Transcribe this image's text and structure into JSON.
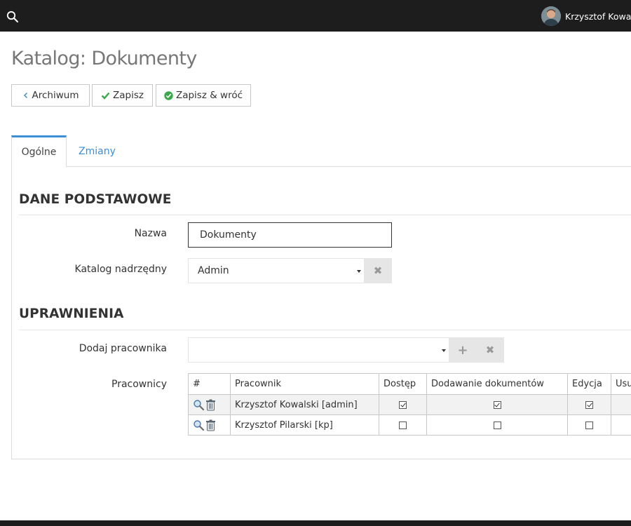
{
  "topbar": {
    "user_name": "Krzysztof Kowals"
  },
  "page": {
    "title": "Katalog: Dokumenty"
  },
  "toolbar": {
    "back_label": "Archiwum",
    "save_label": "Zapisz",
    "save_return_label": "Zapisz & wróć"
  },
  "tabs": [
    {
      "label": "Ogólne",
      "active": true
    },
    {
      "label": "Zmiany",
      "active": false
    }
  ],
  "sections": {
    "basic": {
      "title": "DANE PODSTAWOWE",
      "name_label": "Nazwa",
      "name_value": "Dokumenty",
      "parent_label": "Katalog nadrzędny",
      "parent_value": "Admin"
    },
    "permissions": {
      "title": "UPRAWNIENIA",
      "add_employee_label": "Dodaj pracownika",
      "add_employee_value": "",
      "employees_label": "Pracownicy"
    }
  },
  "employees_table": {
    "columns": [
      "#",
      "Pracownik",
      "Dostęp",
      "Dodawanie dokumentów",
      "Edycja",
      "Usu"
    ],
    "rows": [
      {
        "name": "Krzysztof Kowalski [admin]",
        "access": true,
        "add_docs": true,
        "edit": true
      },
      {
        "name": "Krzysztof Pilarski [kp]",
        "access": false,
        "add_docs": false,
        "edit": false
      }
    ]
  },
  "colors": {
    "topbar": "#1d1d1d",
    "accent": "#3b8fd6",
    "check_green": "#3aa84a"
  },
  "icons": {
    "search": "search-icon",
    "back": "chevron-left-icon",
    "save": "checkmark-icon",
    "save_return": "check-circle-icon",
    "clear": "close-icon",
    "add": "plus-icon",
    "view": "magnifier-icon",
    "delete": "trash-icon"
  }
}
